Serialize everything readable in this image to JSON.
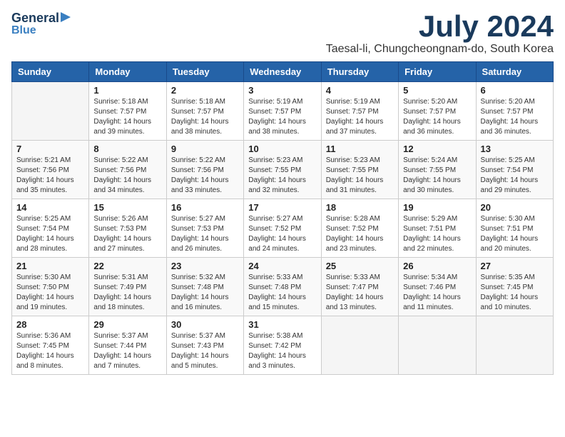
{
  "logo": {
    "general": "General",
    "blue": "Blue",
    "arrow_color": "#3a7fc1"
  },
  "header": {
    "month": "July 2024",
    "location": "Taesal-li, Chungcheongnam-do, South Korea"
  },
  "days_of_week": [
    "Sunday",
    "Monday",
    "Tuesday",
    "Wednesday",
    "Thursday",
    "Friday",
    "Saturday"
  ],
  "weeks": [
    [
      {
        "num": "",
        "info": ""
      },
      {
        "num": "1",
        "info": "Sunrise: 5:18 AM\nSunset: 7:57 PM\nDaylight: 14 hours\nand 39 minutes."
      },
      {
        "num": "2",
        "info": "Sunrise: 5:18 AM\nSunset: 7:57 PM\nDaylight: 14 hours\nand 38 minutes."
      },
      {
        "num": "3",
        "info": "Sunrise: 5:19 AM\nSunset: 7:57 PM\nDaylight: 14 hours\nand 38 minutes."
      },
      {
        "num": "4",
        "info": "Sunrise: 5:19 AM\nSunset: 7:57 PM\nDaylight: 14 hours\nand 37 minutes."
      },
      {
        "num": "5",
        "info": "Sunrise: 5:20 AM\nSunset: 7:57 PM\nDaylight: 14 hours\nand 36 minutes."
      },
      {
        "num": "6",
        "info": "Sunrise: 5:20 AM\nSunset: 7:57 PM\nDaylight: 14 hours\nand 36 minutes."
      }
    ],
    [
      {
        "num": "7",
        "info": "Sunrise: 5:21 AM\nSunset: 7:56 PM\nDaylight: 14 hours\nand 35 minutes."
      },
      {
        "num": "8",
        "info": "Sunrise: 5:22 AM\nSunset: 7:56 PM\nDaylight: 14 hours\nand 34 minutes."
      },
      {
        "num": "9",
        "info": "Sunrise: 5:22 AM\nSunset: 7:56 PM\nDaylight: 14 hours\nand 33 minutes."
      },
      {
        "num": "10",
        "info": "Sunrise: 5:23 AM\nSunset: 7:55 PM\nDaylight: 14 hours\nand 32 minutes."
      },
      {
        "num": "11",
        "info": "Sunrise: 5:23 AM\nSunset: 7:55 PM\nDaylight: 14 hours\nand 31 minutes."
      },
      {
        "num": "12",
        "info": "Sunrise: 5:24 AM\nSunset: 7:55 PM\nDaylight: 14 hours\nand 30 minutes."
      },
      {
        "num": "13",
        "info": "Sunrise: 5:25 AM\nSunset: 7:54 PM\nDaylight: 14 hours\nand 29 minutes."
      }
    ],
    [
      {
        "num": "14",
        "info": "Sunrise: 5:25 AM\nSunset: 7:54 PM\nDaylight: 14 hours\nand 28 minutes."
      },
      {
        "num": "15",
        "info": "Sunrise: 5:26 AM\nSunset: 7:53 PM\nDaylight: 14 hours\nand 27 minutes."
      },
      {
        "num": "16",
        "info": "Sunrise: 5:27 AM\nSunset: 7:53 PM\nDaylight: 14 hours\nand 26 minutes."
      },
      {
        "num": "17",
        "info": "Sunrise: 5:27 AM\nSunset: 7:52 PM\nDaylight: 14 hours\nand 24 minutes."
      },
      {
        "num": "18",
        "info": "Sunrise: 5:28 AM\nSunset: 7:52 PM\nDaylight: 14 hours\nand 23 minutes."
      },
      {
        "num": "19",
        "info": "Sunrise: 5:29 AM\nSunset: 7:51 PM\nDaylight: 14 hours\nand 22 minutes."
      },
      {
        "num": "20",
        "info": "Sunrise: 5:30 AM\nSunset: 7:51 PM\nDaylight: 14 hours\nand 20 minutes."
      }
    ],
    [
      {
        "num": "21",
        "info": "Sunrise: 5:30 AM\nSunset: 7:50 PM\nDaylight: 14 hours\nand 19 minutes."
      },
      {
        "num": "22",
        "info": "Sunrise: 5:31 AM\nSunset: 7:49 PM\nDaylight: 14 hours\nand 18 minutes."
      },
      {
        "num": "23",
        "info": "Sunrise: 5:32 AM\nSunset: 7:48 PM\nDaylight: 14 hours\nand 16 minutes."
      },
      {
        "num": "24",
        "info": "Sunrise: 5:33 AM\nSunset: 7:48 PM\nDaylight: 14 hours\nand 15 minutes."
      },
      {
        "num": "25",
        "info": "Sunrise: 5:33 AM\nSunset: 7:47 PM\nDaylight: 14 hours\nand 13 minutes."
      },
      {
        "num": "26",
        "info": "Sunrise: 5:34 AM\nSunset: 7:46 PM\nDaylight: 14 hours\nand 11 minutes."
      },
      {
        "num": "27",
        "info": "Sunrise: 5:35 AM\nSunset: 7:45 PM\nDaylight: 14 hours\nand 10 minutes."
      }
    ],
    [
      {
        "num": "28",
        "info": "Sunrise: 5:36 AM\nSunset: 7:45 PM\nDaylight: 14 hours\nand 8 minutes."
      },
      {
        "num": "29",
        "info": "Sunrise: 5:37 AM\nSunset: 7:44 PM\nDaylight: 14 hours\nand 7 minutes."
      },
      {
        "num": "30",
        "info": "Sunrise: 5:37 AM\nSunset: 7:43 PM\nDaylight: 14 hours\nand 5 minutes."
      },
      {
        "num": "31",
        "info": "Sunrise: 5:38 AM\nSunset: 7:42 PM\nDaylight: 14 hours\nand 3 minutes."
      },
      {
        "num": "",
        "info": ""
      },
      {
        "num": "",
        "info": ""
      },
      {
        "num": "",
        "info": ""
      }
    ]
  ]
}
